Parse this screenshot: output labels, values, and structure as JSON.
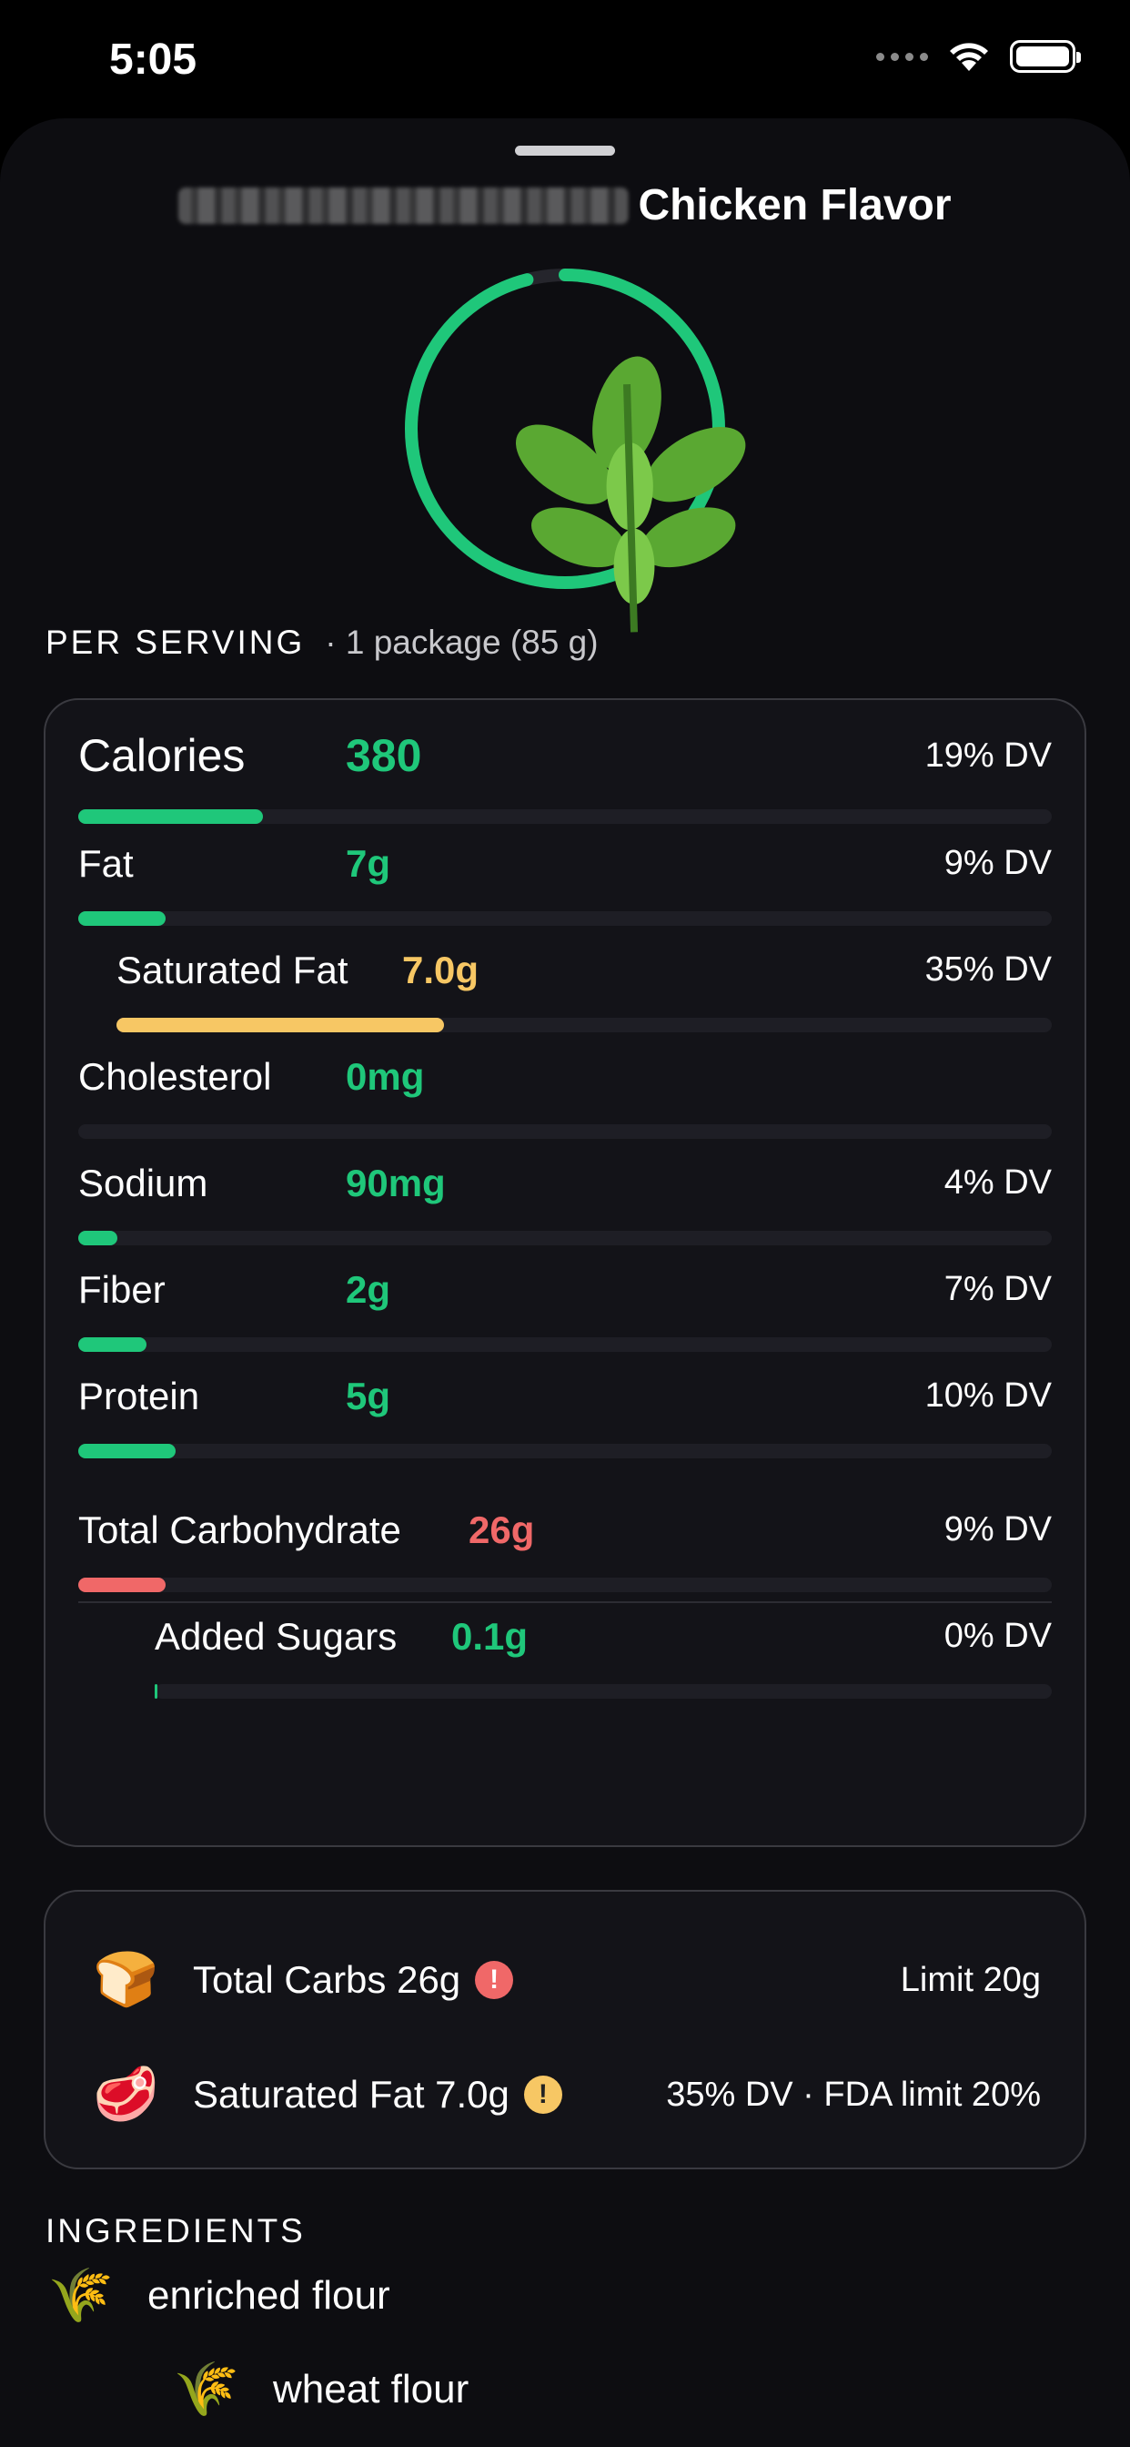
{
  "status_bar": {
    "time": "5:05",
    "icons": [
      "cellular-dots-icon",
      "wifi-icon",
      "battery-icon"
    ]
  },
  "header": {
    "title_redacted": "(0.25 PACKAGE, (MAKES 0.5 SUP))",
    "title": "Chicken Flavor",
    "ring_progress": 0.96,
    "ring_color": "#1fc77a",
    "image_icon": "leaf-icon"
  },
  "serving": {
    "label": "PER SERVING",
    "value": "· 1 package (85 g)"
  },
  "nutrients": [
    {
      "name": "Calories",
      "value": "380",
      "dv": "19% DV",
      "fill": 0.19,
      "color": "#1fc77a",
      "big": true
    },
    {
      "name": "Fat",
      "value": "7g",
      "dv": "9% DV",
      "fill": 0.09,
      "color": "#1fc77a"
    },
    {
      "name": "Saturated Fat",
      "value": "7.0g",
      "dv": "35% DV",
      "fill": 0.35,
      "color": "#f7c764"
    },
    {
      "name": "Cholesterol",
      "value": "0mg",
      "dv": "",
      "fill": 0,
      "color": "#1fc77a"
    },
    {
      "name": "Sodium",
      "value": "90mg",
      "dv": "4% DV",
      "fill": 0.04,
      "color": "#1fc77a"
    },
    {
      "name": "Fiber",
      "value": "2g",
      "dv": "7% DV",
      "fill": 0.07,
      "color": "#1fc77a"
    },
    {
      "name": "Protein",
      "value": "5g",
      "dv": "10% DV",
      "fill": 0.1,
      "color": "#1fc77a"
    },
    {
      "name": "Total Carbohydrate",
      "value": "26g",
      "dv": "9% DV",
      "fill": 0.09,
      "color": "#f06868"
    },
    {
      "name": "Added Sugars",
      "value": "0.1g",
      "dv": "0% DV",
      "fill": 0.002,
      "color": "#1fc77a"
    }
  ],
  "warnings": [
    {
      "icon": "bread-icon",
      "glyph": "🍞",
      "text": "Total Carbs 26g",
      "badge": "!",
      "badge_color": "#f06868",
      "right": "Limit 20g"
    },
    {
      "icon": "steak-icon",
      "glyph": "🥩",
      "text": "Saturated Fat 7.0g",
      "badge": "!",
      "badge_color": "#f7c764",
      "right": "35% DV · FDA limit 20%"
    }
  ],
  "ingredients": {
    "header": "INGREDIENTS",
    "items": [
      {
        "icon": "rice-icon",
        "glyph": "🌾",
        "name": "enriched flour"
      },
      {
        "icon": "rice-icon",
        "glyph": "🌾",
        "name": "wheat flour"
      }
    ]
  }
}
